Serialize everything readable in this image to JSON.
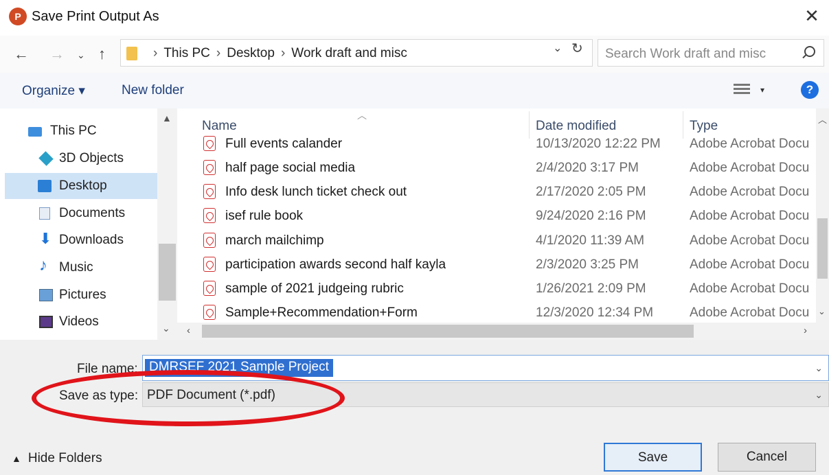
{
  "window": {
    "app_icon": "P",
    "title": "Save Print Output As",
    "close_glyph": "✕"
  },
  "address": {
    "crumbs": [
      "This PC",
      "Desktop",
      "Work draft and misc"
    ],
    "separator": "›",
    "search_placeholder": "Search Work draft and misc"
  },
  "toolbar": {
    "organize": "Organize ▾",
    "new_folder": "New folder",
    "help": "?"
  },
  "nav_pane": {
    "items": [
      {
        "label": "This PC",
        "icon": "computer-icon"
      },
      {
        "label": "3D Objects",
        "icon": "cube-icon"
      },
      {
        "label": "Desktop",
        "icon": "desktop-icon",
        "selected": true
      },
      {
        "label": "Documents",
        "icon": "document-icon"
      },
      {
        "label": "Downloads",
        "icon": "download-arrow-icon"
      },
      {
        "label": "Music",
        "icon": "music-note-icon"
      },
      {
        "label": "Pictures",
        "icon": "pictures-icon"
      },
      {
        "label": "Videos",
        "icon": "video-icon"
      }
    ]
  },
  "file_list": {
    "columns": {
      "name": "Name",
      "date": "Date modified",
      "type": "Type"
    },
    "rows": [
      {
        "name": "Full events calander",
        "date": "10/13/2020 12:22 PM",
        "type": "Adobe Acrobat Docu"
      },
      {
        "name": "half page social media",
        "date": "2/4/2020 3:17 PM",
        "type": "Adobe Acrobat Docu"
      },
      {
        "name": "Info desk lunch ticket check out",
        "date": "2/17/2020 2:05 PM",
        "type": "Adobe Acrobat Docu"
      },
      {
        "name": "isef rule book",
        "date": "9/24/2020 2:16 PM",
        "type": "Adobe Acrobat Docu"
      },
      {
        "name": "march mailchimp",
        "date": "4/1/2020 11:39 AM",
        "type": "Adobe Acrobat Docu"
      },
      {
        "name": "participation awards second half kayla",
        "date": "2/3/2020 3:25 PM",
        "type": "Adobe Acrobat Docu"
      },
      {
        "name": "sample of 2021 judgeing rubric",
        "date": "1/26/2021 2:09 PM",
        "type": "Adobe Acrobat Docu"
      },
      {
        "name": "Sample+Recommendation+Form",
        "date": "12/3/2020 12:34 PM",
        "type": "Adobe Acrobat Docu"
      }
    ]
  },
  "form": {
    "file_name_label": "File name:",
    "file_name_value": "DMRSEF 2021 Sample Project",
    "save_type_label": "Save as type:",
    "save_type_value": "PDF Document (*.pdf)"
  },
  "footer": {
    "hide_folders": "Hide Folders",
    "save": "Save",
    "cancel": "Cancel"
  },
  "colors": {
    "accent": "#2f6fd0",
    "selection": "#cfe3f7",
    "annotation": "#e0141a"
  }
}
